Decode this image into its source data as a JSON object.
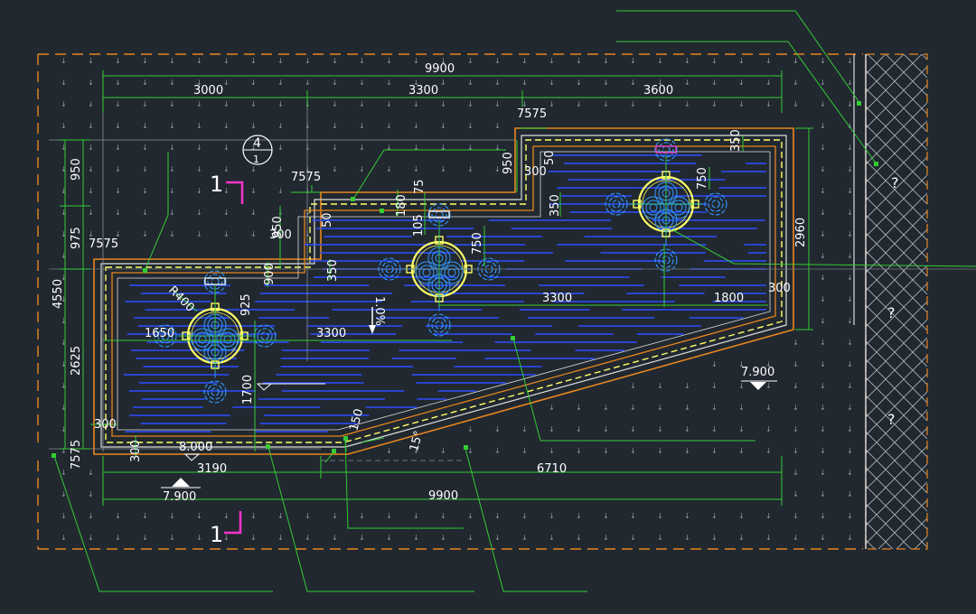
{
  "drawing": {
    "colors": {
      "background": "#212830",
      "border": "#e8861e",
      "dimension": "#33cc33",
      "wall_inner": "#ffff66",
      "water_line": "#3355ff",
      "fountain": "#3399ff",
      "section_mark": "#ff33cc",
      "text": "#ffffff",
      "wall": "#ffffff"
    },
    "dims": {
      "total_top": "9900",
      "seg1": "3000",
      "seg2": "3300",
      "seg3": "3600",
      "step_top": "7575",
      "step_mid": "7575",
      "step_left": "7575",
      "left_950": "950",
      "left_975": "975",
      "left_4550": "4550",
      "left_2625": "2625",
      "bot_7575": "7575",
      "d950_a": "950",
      "d950_b": "950",
      "d300_a": "300",
      "d300_b": "300",
      "d300_c": "300",
      "d300_d": "300",
      "d300_e": "300",
      "d50_a": "50",
      "d50_b": "50",
      "d180": "180",
      "d75": "75",
      "d105": "105",
      "d350_a": "350",
      "d350_b": "350",
      "d350_c": "350",
      "d750_a": "750",
      "d750_b": "750",
      "d900": "900",
      "d925": "925",
      "r400": "R400",
      "d1650": "1650",
      "d3300_a": "3300",
      "d3300_b": "3300",
      "d1800": "1800",
      "d2960": "2960",
      "d1700": "1700",
      "d150": "150",
      "angle": "15°",
      "slope": "1.0%",
      "bot_3190": "3190",
      "bot_6710": "6710",
      "bot_9900": "9900",
      "elev_a": "7.900",
      "elev_b": "7.900",
      "elev_c": "8.000",
      "section_top": "1",
      "section_bot": "1",
      "grid_top": "4",
      "grid_bot": "1",
      "q1": "?",
      "q2": "?",
      "q3": "?"
    }
  }
}
